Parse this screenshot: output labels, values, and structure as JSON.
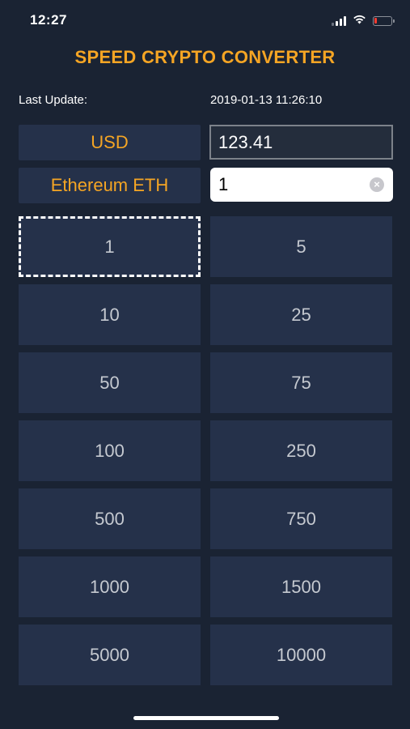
{
  "status_bar": {
    "time": "12:27",
    "icons": [
      "signal-icon",
      "wifi-icon",
      "battery-icon"
    ],
    "battery_level": 0.1,
    "battery_color": "#ff3b30"
  },
  "app": {
    "title": "SPEED CRYPTO CONVERTER",
    "accent_color": "#f5a524",
    "background_color": "#1a2333"
  },
  "last_update": {
    "label": "Last Update:",
    "value": "2019-01-13 11:26:10"
  },
  "fiat": {
    "label": "USD",
    "value": "123.41"
  },
  "crypto": {
    "label": "Ethereum ETH",
    "value": "1"
  },
  "amounts": [
    "1",
    "5",
    "10",
    "25",
    "50",
    "75",
    "100",
    "250",
    "500",
    "750",
    "1000",
    "1500",
    "5000",
    "10000"
  ],
  "selected_amount": "1"
}
